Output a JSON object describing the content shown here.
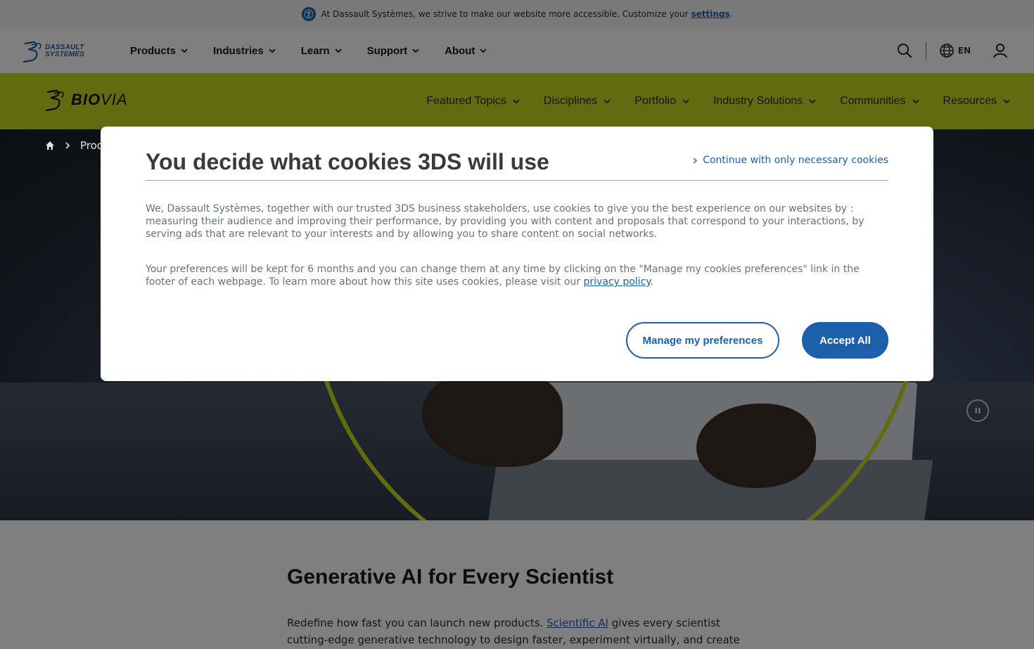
{
  "a11y_banner": {
    "text": "At Dassault Systèmes, we strive to make our website more accessible. Customize your",
    "link": "settings",
    "suffix": ".",
    "icon": "accessibility-icon"
  },
  "header": {
    "logo_line1": "DASSAULT",
    "logo_line2": "SYSTEMES",
    "nav": [
      {
        "label": "Products"
      },
      {
        "label": "Industries"
      },
      {
        "label": "Learn"
      },
      {
        "label": "Support"
      },
      {
        "label": "About"
      }
    ],
    "language": "EN",
    "icons": [
      "search-icon",
      "globe-icon",
      "user-icon"
    ]
  },
  "brand": {
    "logo_bold": "BIO",
    "logo_light": "VIA",
    "nav": [
      {
        "label": "Featured Topics"
      },
      {
        "label": "Disciplines"
      },
      {
        "label": "Portfolio"
      },
      {
        "label": "Industry Solutions"
      },
      {
        "label": "Communities"
      },
      {
        "label": "Resources"
      }
    ],
    "color": "#c5d61e"
  },
  "breadcrumb": {
    "visible_text": "Prod"
  },
  "content": {
    "heading": "Generative AI for Every Scientist",
    "text_before": "Redefine how fast you can launch new products.",
    "link": "Scientific AI",
    "text_after": "gives every scientist cutting-edge generative technology to design faster, experiment virtually, and create more successful"
  },
  "cookie_modal": {
    "title": "You decide what cookies 3DS will use",
    "necessary_link": "Continue with only necessary cookies",
    "paragraph1": "We, Dassault Systèmes, together with our trusted 3DS business stakeholders, use cookies to give you the best experience on our websites by : measuring their audience and improving their performance, by providing you with content and proposals that correspond to your interactions, by serving ads that are relevant to your interests and by allowing you to share content on social networks.",
    "paragraph2": "Your preferences will be kept for 6 months and you can change them at any time by clicking on the \"Manage my cookies preferences\" link in the footer of each webpage. To learn more about how this site uses cookies, please visit our",
    "privacy_link": "privacy policy",
    "paragraph2_end": ".",
    "manage_button": "Manage my preferences",
    "accept_button": "Accept All"
  },
  "colors": {
    "primary_blue": "#1c5fab",
    "lime": "#c5d61e"
  }
}
